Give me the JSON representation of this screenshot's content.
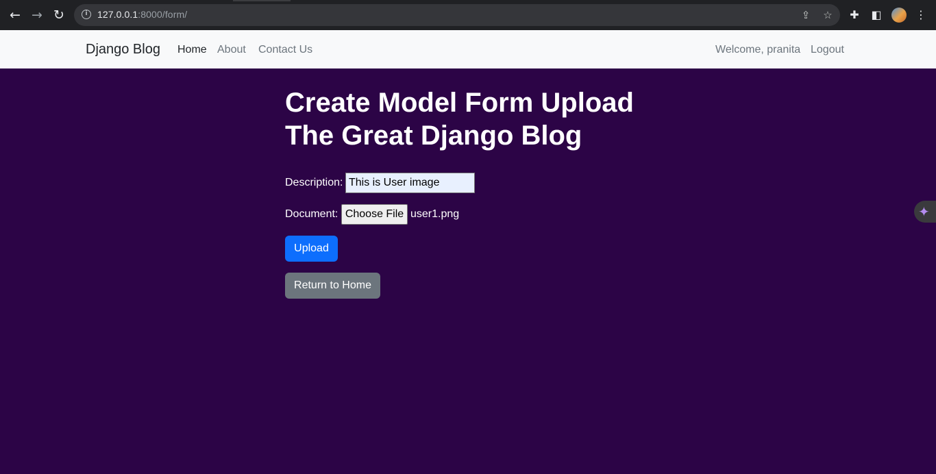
{
  "browser": {
    "url_host": "127.0.0.1",
    "url_path": ":8000/form/",
    "back_icon": "←",
    "forward_icon": "→",
    "reload_icon": "↻",
    "share_icon": "⇪",
    "star_icon": "☆",
    "extensions_icon": "✚",
    "sidepanel_icon": "◧",
    "menu_icon": "⋮",
    "info_icon": "i"
  },
  "navbar": {
    "brand": "Django Blog",
    "links": [
      "Home",
      "About",
      "Contact Us"
    ],
    "welcome": "Welcome, pranita",
    "logout": "Logout"
  },
  "main": {
    "title_line1": "Create Model Form Upload",
    "title_line2": "The Great Django Blog",
    "description_label": "Description:",
    "description_value": "This is User image",
    "document_label": "Document:",
    "choose_file_label": "Choose File",
    "file_name": "user1.png",
    "upload_label": "Upload",
    "return_label": "Return to Home"
  },
  "side": {
    "sparkle_icon": "✦"
  },
  "colors": {
    "page_bg": "#2c0446",
    "navbar_bg": "#f8f9fa",
    "primary": "#0d6efd",
    "secondary": "#6c757d"
  }
}
